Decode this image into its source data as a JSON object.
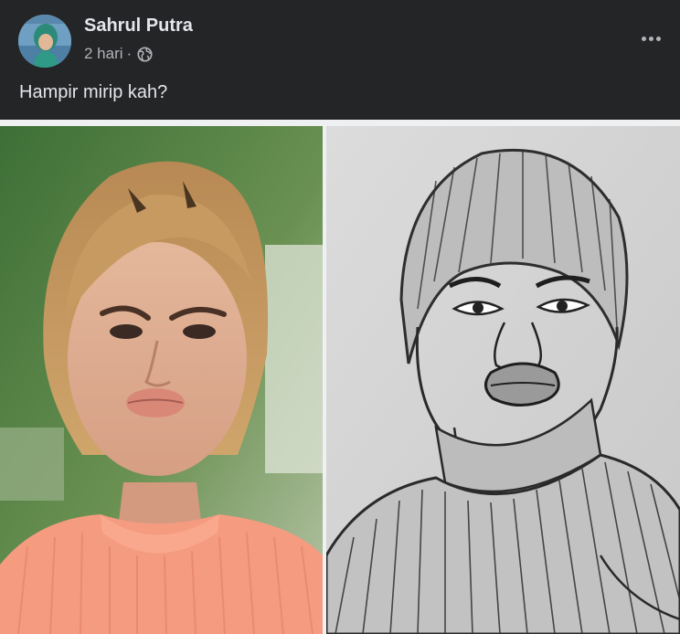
{
  "post": {
    "author": "Sahrul Putra",
    "time": "2 hari",
    "separator": "·",
    "caption": "Hampir mirip kah?",
    "privacy_icon": "globe-icon",
    "more_icon": "more-options-icon"
  },
  "colors": {
    "background": "#242526",
    "primary_text": "#e4e6eb",
    "secondary_text": "#b0b3b8",
    "divider": "#eef0f1"
  }
}
